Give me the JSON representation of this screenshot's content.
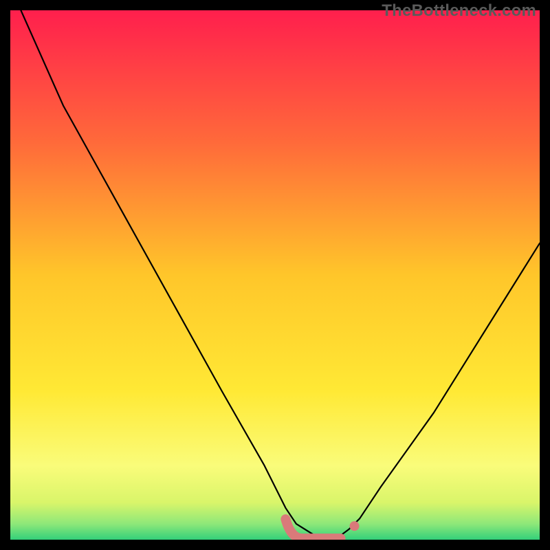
{
  "watermark": "TheBottleneck.com",
  "chart_data": {
    "type": "line",
    "title": "",
    "xlabel": "",
    "ylabel": "",
    "xlim": [
      0,
      100
    ],
    "ylim": [
      0,
      100
    ],
    "series": [
      {
        "name": "bottleneck-curve",
        "x": [
          2,
          10,
          20,
          30,
          40,
          48,
          52,
          54,
          58,
          62,
          64,
          66,
          70,
          80,
          90,
          100
        ],
        "y": [
          100,
          82,
          64,
          46,
          28,
          14,
          6,
          3,
          0.5,
          0.5,
          2,
          4,
          10,
          24,
          40,
          56
        ]
      }
    ],
    "highlight": {
      "name": "flat-minimum",
      "x_range": [
        52,
        65
      ],
      "y": 0.5
    },
    "gradient_stops": [
      {
        "pos": 0.0,
        "color": "#ff1f4d"
      },
      {
        "pos": 0.25,
        "color": "#ff6a3a"
      },
      {
        "pos": 0.5,
        "color": "#ffc62a"
      },
      {
        "pos": 0.72,
        "color": "#ffe935"
      },
      {
        "pos": 0.86,
        "color": "#fafc7a"
      },
      {
        "pos": 0.93,
        "color": "#d9f56a"
      },
      {
        "pos": 0.97,
        "color": "#8ee879"
      },
      {
        "pos": 1.0,
        "color": "#33d07a"
      }
    ]
  }
}
